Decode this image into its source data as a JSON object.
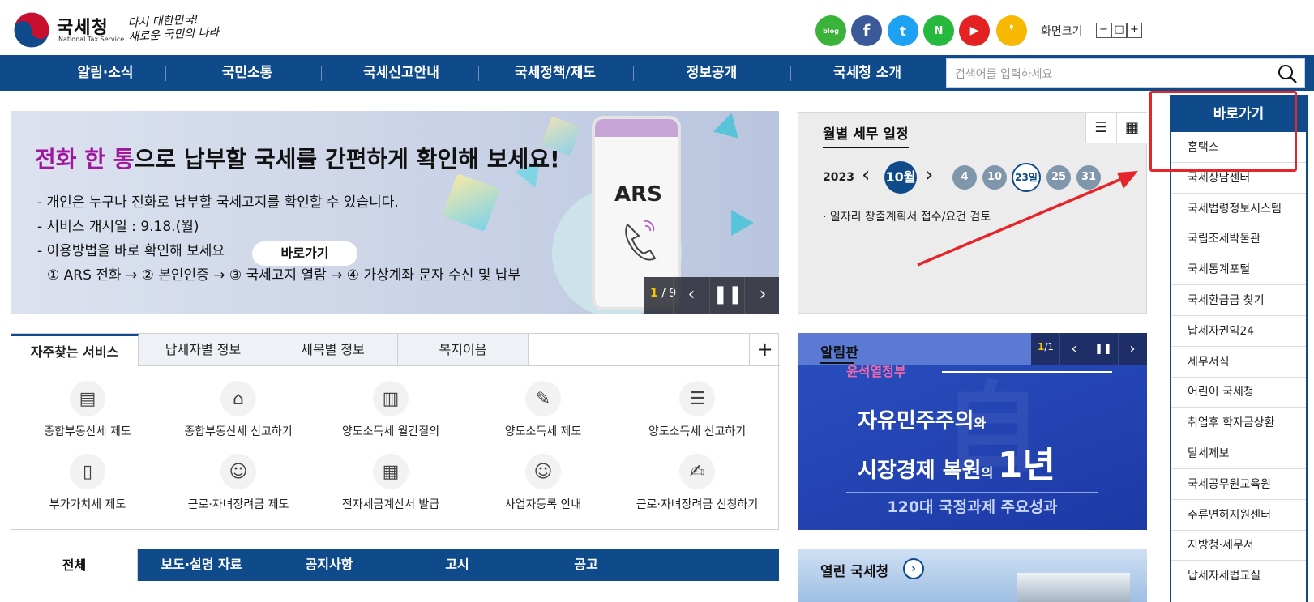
{
  "header": {
    "logo_text": "국세청",
    "logo_sub": "National Tax Service",
    "slogan_line1": "다시 대한민국!",
    "slogan_line2": "새로운 국민의 나라",
    "sns": [
      {
        "name": "blog",
        "glyph": "blog"
      },
      {
        "name": "facebook",
        "glyph": "f"
      },
      {
        "name": "twitter",
        "glyph": "t"
      },
      {
        "name": "naver-post",
        "glyph": "N"
      },
      {
        "name": "youtube",
        "glyph": "▶"
      },
      {
        "name": "kakao",
        "glyph": "❜"
      }
    ],
    "font_size_label": "화면크기",
    "font_minus": "−",
    "font_reset": "□",
    "font_plus": "+"
  },
  "nav": {
    "items": [
      "알림·소식",
      "국민소통",
      "국세신고안내",
      "국세정책/제도",
      "정보공개",
      "국세청 소개"
    ],
    "search_placeholder": "검색어를 입력하세요"
  },
  "banner": {
    "title_hl1": "전화 한 통",
    "title_rest": "으로 납부할 국세를 간편하게 확인해 보세요!",
    "line1": "- 개인은 누구나 전화로 납부할 국세고지를 확인할 수 있습니다.",
    "line2": "- 서비스 개시일 : 9.18.(월)",
    "line3": "- 이용방법을 바로 확인해 보세요",
    "line4": "① ARS 전화 → ② 본인인증 → ③ 국세고지 열람 → ④ 가상계좌 문자 수신 및 납부",
    "button": "바로가기",
    "ars": "ARS",
    "page_current": "1",
    "page_total": "/ 9"
  },
  "schedule": {
    "title": "월별 세무 일정",
    "year": "2023",
    "month": "10월",
    "days": [
      "4",
      "10",
      "23일",
      "25",
      "31"
    ],
    "selected_index": 2,
    "event": "· 일자리 창출계획서 접수/요건 검토"
  },
  "quick": {
    "title": "바로가기",
    "items": [
      "홈택스",
      "국세상담센터",
      "국세법령정보시스템",
      "국립조세박물관",
      "국세통계포털",
      "국세환급금 찾기",
      "납세자권익24",
      "세무서식",
      "어린이 국세청",
      "취업후 학자금상환",
      "탈세제보",
      "국세공무원교육원",
      "주류면허지원센터",
      "지방청·세무서",
      "납세자세법교실"
    ]
  },
  "services": {
    "tabs": [
      "자주찾는 서비스",
      "납세자별 정보",
      "세목별 정보",
      "복지이음"
    ],
    "plus": "+",
    "items": [
      "종합부동산세 제도",
      "종합부동산세 신고하기",
      "양도소득세 월간질의",
      "양도소득세 제도",
      "양도소득세 신고하기",
      "부가가치세 제도",
      "근로·자녀장려금 제도",
      "전자세금계산서 발급",
      "사업자등록 안내",
      "근로·자녀장려금 신청하기"
    ]
  },
  "board": {
    "title": "알림판",
    "page_current": "1",
    "page_total": "/1",
    "sub": "윤석열정부",
    "line1_a": "자유민주주의",
    "line1_b": "와",
    "line2_a": "시장경제 복원",
    "line2_b": "의 ",
    "line2_c": "1년",
    "foot": "120대 국정과제 주요성과"
  },
  "news": {
    "tabs": [
      "전체",
      "보도·설명 자료",
      "공지사항",
      "고시",
      "공고"
    ]
  },
  "open": {
    "title": "열린 국세청",
    "arrow": "›"
  },
  "colors": {
    "brand_blue": "#0f4a8a",
    "highlight_red": "#e4262b",
    "banner_accent": "#a0169c"
  }
}
